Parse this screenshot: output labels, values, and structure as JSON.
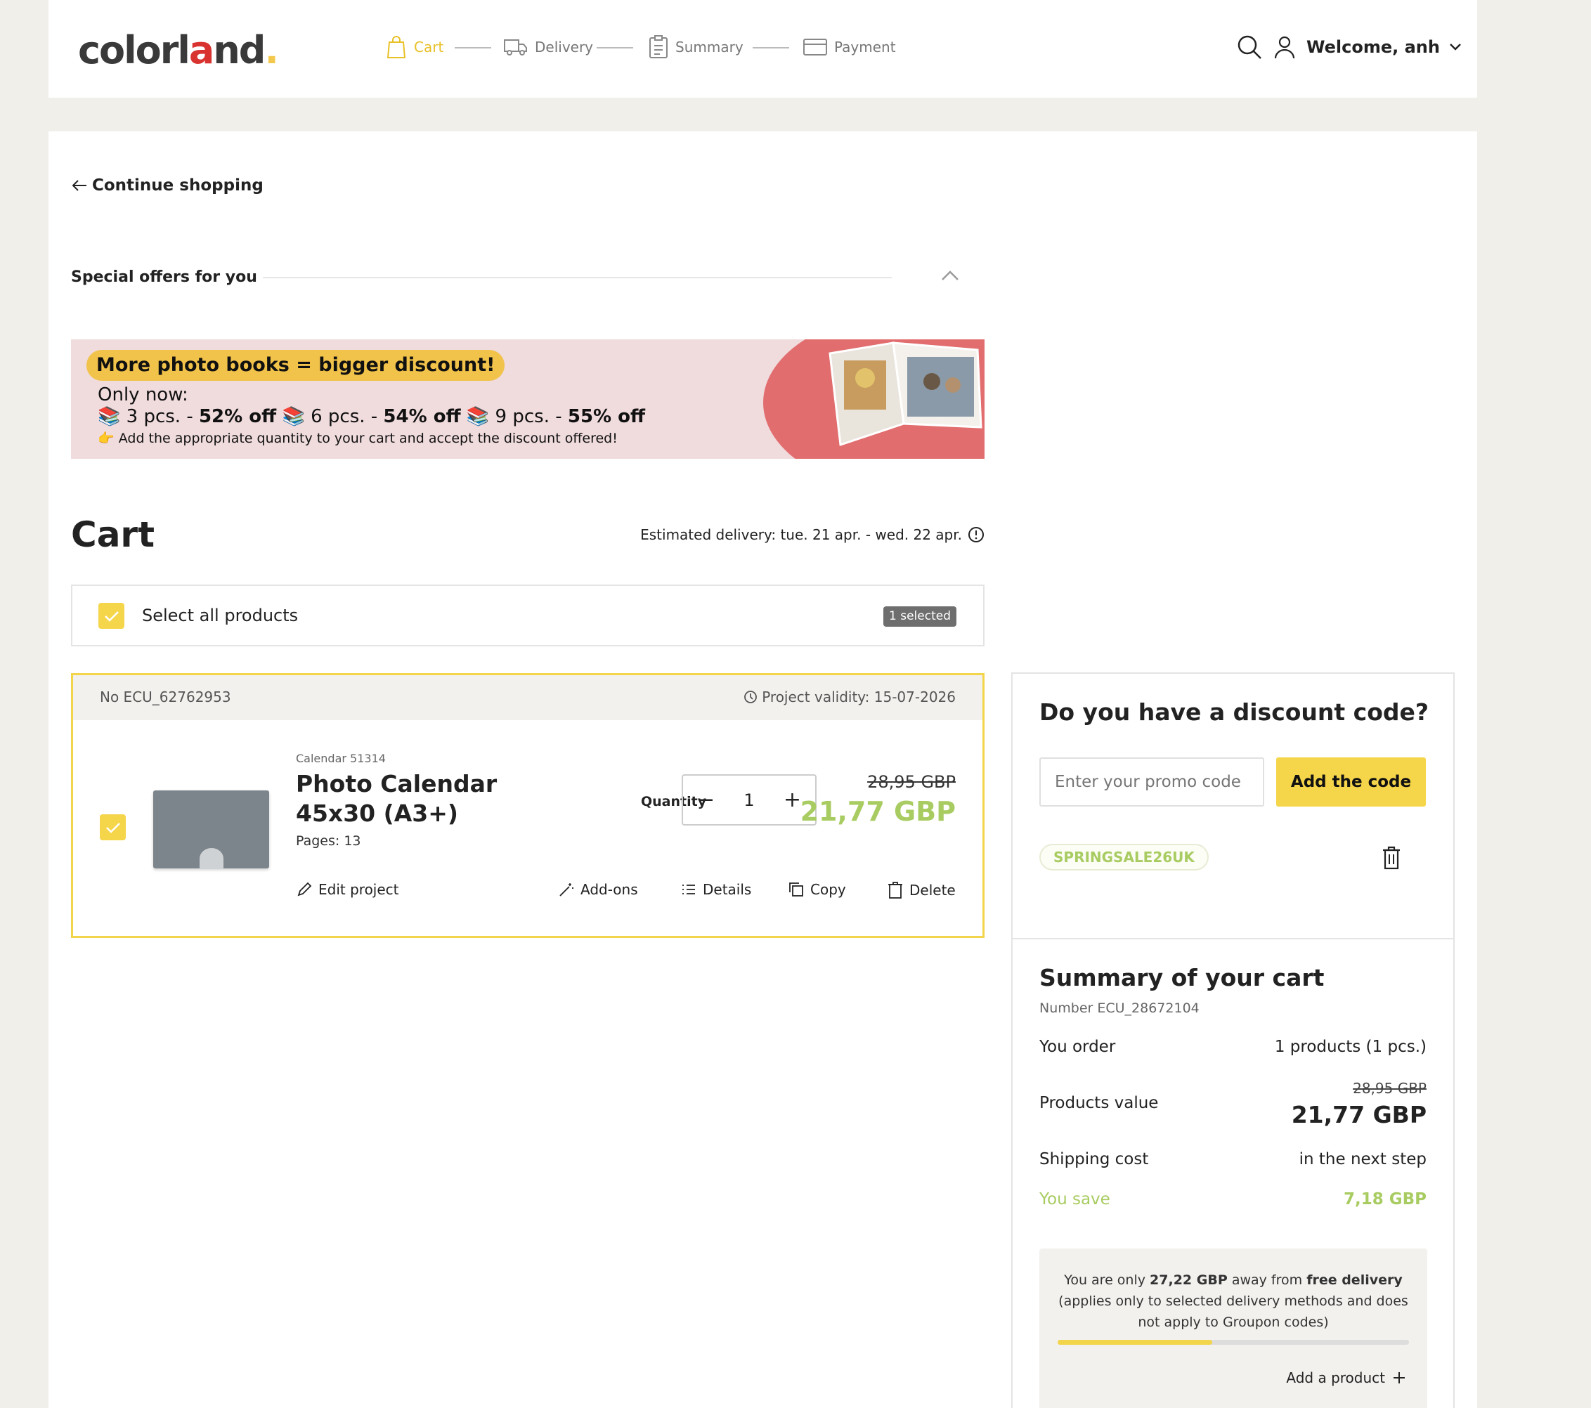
{
  "header": {
    "logo": {
      "pre": "color",
      "mid": "l",
      "dot": "a",
      "post": "nd",
      "tail": "."
    },
    "steps": [
      {
        "label": "Cart",
        "active": true
      },
      {
        "label": "Delivery",
        "active": false
      },
      {
        "label": "Summary",
        "active": false
      },
      {
        "label": "Payment",
        "active": false
      }
    ],
    "welcome": "Welcome, anh"
  },
  "nav": {
    "continue_shopping": "Continue shopping"
  },
  "offers": {
    "title": "Special offers for you",
    "banner": {
      "headline": "More photo books = bigger discount!",
      "line2": "Only now:",
      "tier1_qty": "3 pcs. -",
      "tier1_off": "52% off",
      "tier2_qty": "6 pcs. -",
      "tier2_off": "54% off",
      "tier3_qty": "9 pcs. -",
      "tier3_off": "55% off",
      "line4": "Add the appropriate quantity to your cart and accept the discount offered!"
    }
  },
  "cart": {
    "title": "Cart",
    "estimated_delivery": "Estimated delivery: tue. 21 apr. - wed. 22 apr.",
    "select_all": "Select all products",
    "selected_badge": "1 selected",
    "item": {
      "number": "No ECU_62762953",
      "validity": "Project validity: 15-07-2026",
      "category": "Calendar 51314",
      "name": "Photo Calendar 45x30 (A3+)",
      "pages": "Pages: 13",
      "quantity_label": "Quantity",
      "quantity": "1",
      "old_price": "28,95 GBP",
      "price": "21,77 GBP",
      "actions": {
        "edit": "Edit project",
        "addons": "Add-ons",
        "details": "Details",
        "copy": "Copy",
        "delete": "Delete"
      }
    }
  },
  "discount": {
    "title": "Do you have a discount code?",
    "placeholder": "Enter your promo code",
    "button": "Add the code",
    "applied_code": "SPRINGSALE26UK"
  },
  "summary": {
    "title": "Summary of your cart",
    "number": "Number ECU_28672104",
    "order_label": "You order",
    "order_value": "1 products (1 pcs.)",
    "products_label": "Products value",
    "products_old": "28,95 GBP",
    "products_value": "21,77 GBP",
    "shipping_label": "Shipping cost",
    "shipping_value": "in the next step",
    "save_label": "You save",
    "save_value": "7,18 GBP",
    "free_pre": "You are only",
    "free_amount": "27,22 GBP",
    "free_mid": "away from",
    "free_bold": "free delivery",
    "free_note": "(applies only to selected delivery methods and does not apply to Groupon codes)",
    "free_progress": 0.44,
    "add_product": "Add a product"
  },
  "colors": {
    "accent": "#f5d54a",
    "green": "#a8cc61",
    "banner_bg": "#f0dbdd"
  }
}
